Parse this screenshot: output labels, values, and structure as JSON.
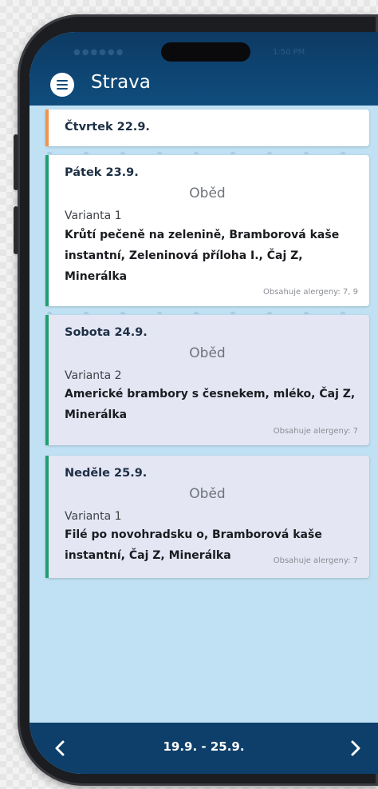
{
  "status_bar": {
    "left": "●●●●●●",
    "right": "1:50 PM"
  },
  "header": {
    "title": "Strava",
    "menu_icon": "hamburger-icon"
  },
  "colors": {
    "today_stripe": "#f0934e",
    "day_stripe": "#1f9f6e",
    "appbar": "#0f4d7e",
    "background": "#bfe1f3"
  },
  "days": [
    {
      "date": "Čtvrtek 22.9."
    },
    {
      "date": "Pátek 23.9.",
      "meal": "Oběd",
      "variant": "Varianta 1",
      "dish": "Krůtí pečeně na zelenině, Bramborová kaše instantní, Zeleninová příloha I., Čaj Z, Minerálka",
      "allergens": "Obsahuje alergeny: 7, 9"
    },
    {
      "date": "Sobota 24.9.",
      "meal": "Oběd",
      "variant": "Varianta 2",
      "dish": "Americké brambory s česnekem, mléko, Čaj Z, Minerálka",
      "allergens": "Obsahuje alergeny: 7"
    },
    {
      "date": "Neděle 25.9.",
      "meal": "Oběd",
      "variant": "Varianta 1",
      "dish": "Filé po novohradsku o, Bramborová kaše instantní, Čaj Z, Minerálka",
      "allergens": "Obsahuje alergeny: 7"
    }
  ],
  "footer": {
    "range": "19.9. - 25.9.",
    "prev_icon": "chevron-left-icon",
    "next_icon": "chevron-right-icon"
  }
}
